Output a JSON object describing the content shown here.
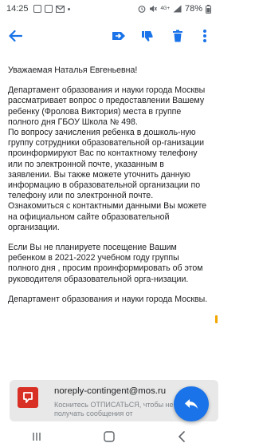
{
  "status_bar": {
    "time": "14:25",
    "battery": "78%",
    "network": "4G+"
  },
  "app_bar": {
    "icons": [
      "back-arrow-icon",
      "move-to-icon",
      "thumbs-down-icon",
      "delete-icon",
      "more-vert-icon"
    ],
    "accent": "#1a73e8"
  },
  "email": {
    "greeting": "Уважаемая Наталья Евгеньевна!",
    "paragraph1": "Департамент образования и науки города Москвы рассматривает вопрос о предоставлении Вашему ребенку (Фролова Виктория) места в группе полного дня ГБОУ Школа № 498.\nПо вопросу зачисления ребенка в дошколь-ную группу сотрудники образовательной ор-ганизации проинформируют Вас по контактному телефону или по электронной почте, указанным в заявлении. Вы также можете уточнить данную информацию в образовательной организации по телефону или по электронной почте. Ознакомиться с контактными данными Вы можете на официальном сайте образовательной организации.",
    "paragraph2": "Если Вы не планируете посещение Вашим ребенком в 2021-2022 учебном году группы полного дня , просим проинформировать об этом руководителя образовательной орга-низации.",
    "signature": "Департамент образования и науки города Москвы."
  },
  "footer": {
    "sender": "noreply-contingent@mos.ru",
    "hint": "Коснитесь ОТПИСАТЬСЯ, чтобы не получать сообщения от",
    "logo_color": "#d93025"
  },
  "fab": {
    "icon": "reply-icon",
    "color": "#1a73e8"
  },
  "nav_bar": {
    "icons": [
      "recent-apps-icon",
      "home-icon",
      "nav-back-icon"
    ]
  }
}
